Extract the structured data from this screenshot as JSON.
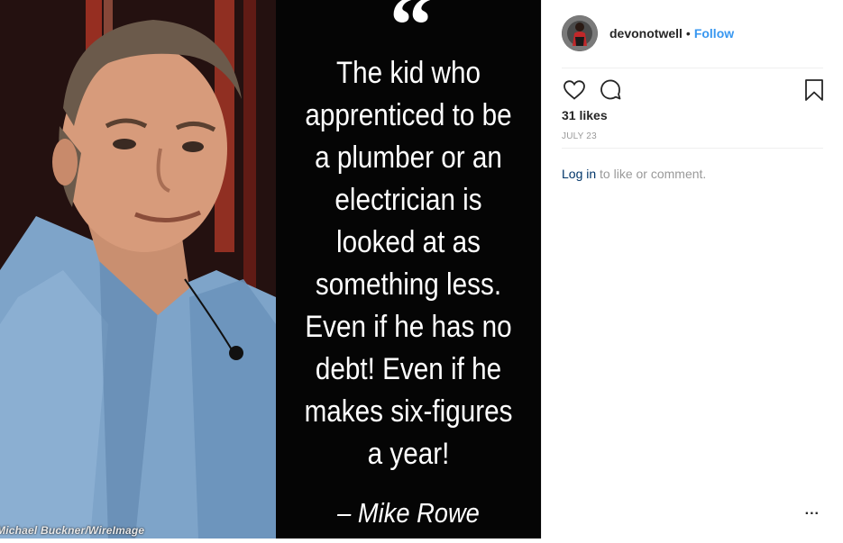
{
  "post_image": {
    "quote_mark": "“",
    "quote_lines": [
      "The kid who",
      "apprenticed to be",
      "a plumber or an",
      "electrician is",
      "looked at as",
      "something less.",
      "Even if he has no",
      "debt! Even if he",
      "makes six-figures",
      "a year!"
    ],
    "author": "– Mike Rowe",
    "photo_credit": "Michael Buckner/WireImage"
  },
  "header": {
    "username": "devonotwell",
    "separator": "•",
    "follow_label": "Follow",
    "avatar_icon": "profile-photo"
  },
  "actions": {
    "like_icon": "heart-icon",
    "comment_icon": "comment-bubble-icon",
    "save_icon": "bookmark-icon"
  },
  "likes_text": "31 likes",
  "date_text": "JULY 23",
  "login": {
    "link_label": "Log in",
    "suffix": " to like or comment."
  },
  "more_label": "...",
  "colors": {
    "follow_blue": "#3897f0",
    "login_link": "#003569",
    "muted_text": "#999999",
    "primary_text": "#262626"
  }
}
